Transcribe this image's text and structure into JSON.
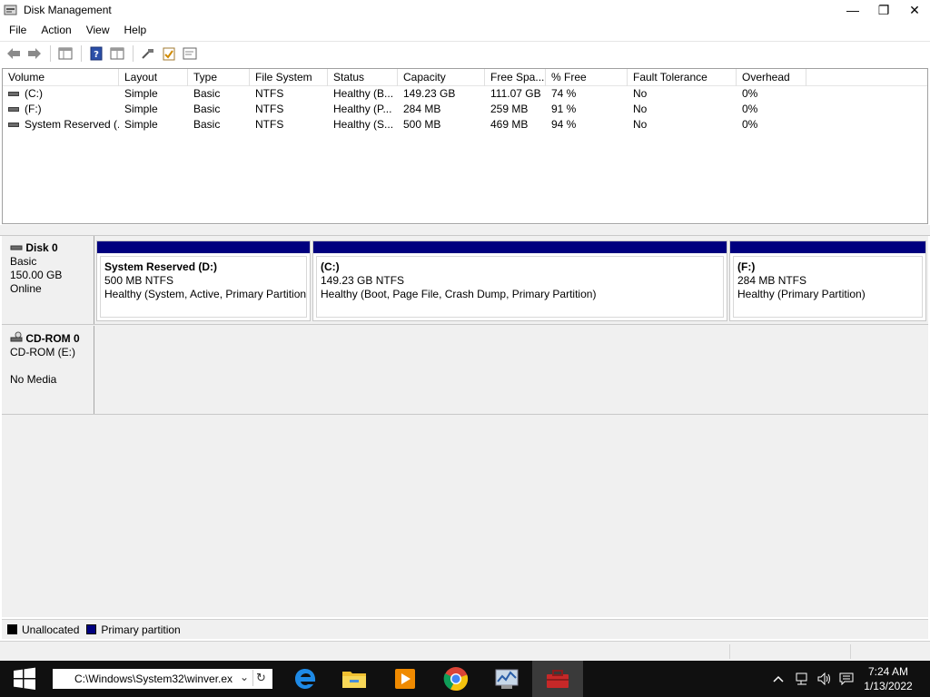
{
  "window": {
    "title": "Disk Management",
    "minimize_glyph": "—",
    "restore_glyph": "❐",
    "close_glyph": "✕"
  },
  "menu": [
    "File",
    "Action",
    "View",
    "Help"
  ],
  "toolbar": {
    "icons": [
      "back-icon",
      "forward-icon",
      "properties-icon",
      "help-icon",
      "show-hide-icon",
      "connect-icon",
      "checklist-icon",
      "console-icon"
    ]
  },
  "volume_list": {
    "columns": [
      "Volume",
      "Layout",
      "Type",
      "File System",
      "Status",
      "Capacity",
      "Free Spa...",
      "% Free",
      "Fault Tolerance",
      "Overhead"
    ],
    "rows": [
      [
        "(C:)",
        "Simple",
        "Basic",
        "NTFS",
        "Healthy (B...",
        "149.23 GB",
        "111.07 GB",
        "74 %",
        "No",
        "0%"
      ],
      [
        "(F:)",
        "Simple",
        "Basic",
        "NTFS",
        "Healthy (P...",
        "284 MB",
        "259 MB",
        "91 %",
        "No",
        "0%"
      ],
      [
        "System Reserved (...",
        "Simple",
        "Basic",
        "NTFS",
        "Healthy (S...",
        "500 MB",
        "469 MB",
        "94 %",
        "No",
        "0%"
      ]
    ]
  },
  "disks": [
    {
      "name": "Disk 0",
      "line2": "Basic",
      "line3": "150.00 GB",
      "line4": "Online",
      "partitions": [
        {
          "name": "System Reserved  (D:)",
          "size": "500 MB NTFS",
          "status": "Healthy (System, Active, Primary Partition)"
        },
        {
          "name": "(C:)",
          "size": "149.23 GB NTFS",
          "status": "Healthy (Boot, Page File, Crash Dump, Primary Partition)"
        },
        {
          "name": "(F:)",
          "size": "284 MB NTFS",
          "status": "Healthy (Primary Partition)"
        }
      ]
    },
    {
      "name": "CD-ROM 0",
      "line2": "CD-ROM (E:)",
      "line3": "",
      "line4": "No Media",
      "partitions": []
    }
  ],
  "legend": [
    {
      "label": "Unallocated",
      "color": "#000000"
    },
    {
      "label": "Primary partition",
      "color": "#00007f"
    }
  ],
  "colors": {
    "primary_partition": "#00007f",
    "taskbar": "#101010"
  },
  "taskbar": {
    "run_text": "C:\\Windows\\System32\\winver.ex",
    "apps": [
      "edge-icon",
      "file-explorer-icon",
      "media-player-icon",
      "chrome-icon",
      "performance-monitor-icon",
      "toolbox-icon"
    ],
    "time": "7:24 AM",
    "date": "1/13/2022"
  }
}
